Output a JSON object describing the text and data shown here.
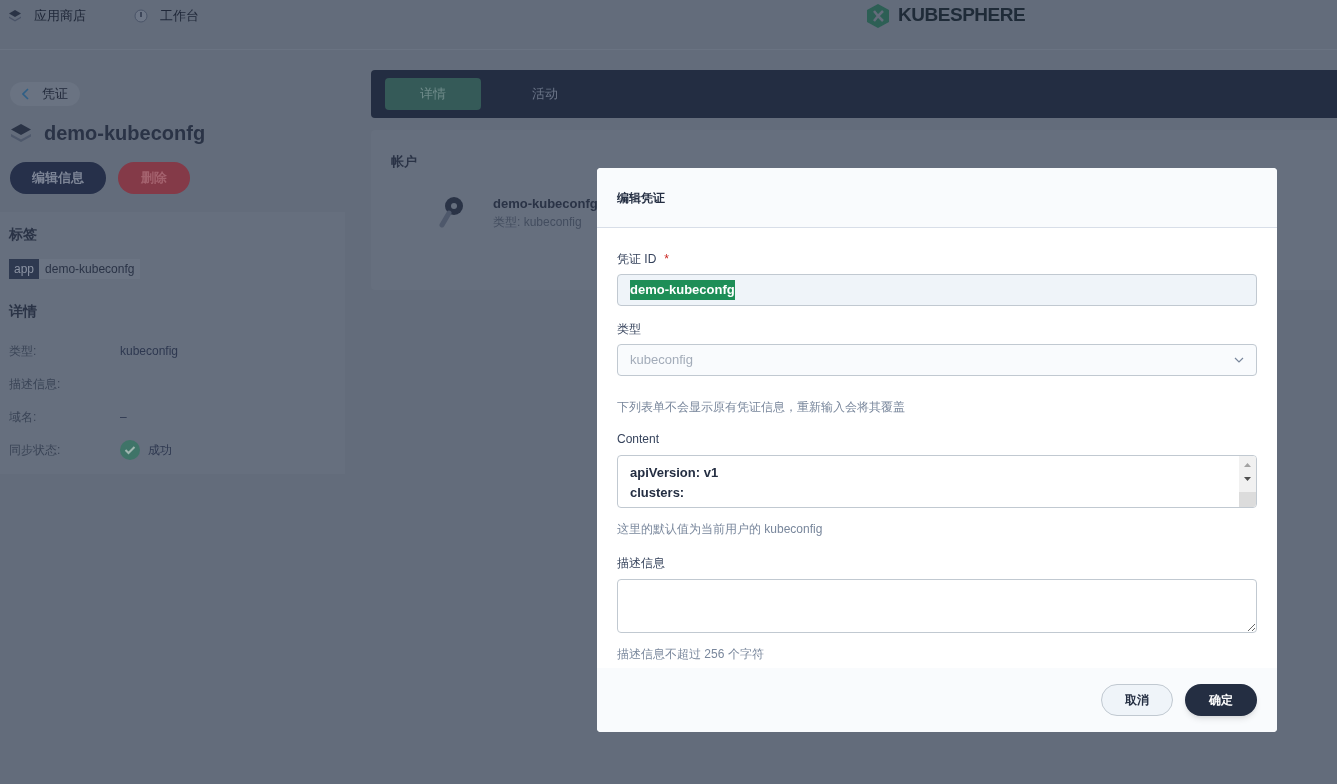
{
  "top_nav": {
    "items": [
      {
        "label": "应用商店",
        "kind": "store"
      },
      {
        "label": "工作台",
        "kind": "workbench"
      }
    ],
    "logo_text": "KUBESPHERE"
  },
  "sidebar": {
    "back_label": "凭证",
    "title": "demo-kubeconfg",
    "buttons": [
      {
        "label": "编辑信息",
        "kind": "primary"
      },
      {
        "label": "删除",
        "kind": "danger"
      }
    ],
    "labels_heading": "标签",
    "tags": [
      {
        "key": "app",
        "value": "demo-kubeconfg"
      }
    ],
    "details_heading": "详情",
    "details": [
      {
        "label": "类型:",
        "value": "kubeconfig",
        "kind": "text"
      },
      {
        "label": "描述信息:",
        "kind": "text"
      },
      {
        "label": "域名:",
        "value": "–",
        "kind": "text"
      },
      {
        "label": "同步状态:",
        "value": "成功",
        "kind": "status"
      }
    ]
  },
  "tabs": [
    {
      "label": "详情",
      "selected": true
    },
    {
      "label": "活动",
      "selected": false
    }
  ],
  "account": {
    "heading": "帐户",
    "name": "demo-kubeconfg",
    "type_text": "类型: kubeconfig"
  },
  "dialog": {
    "title": "编辑凭证",
    "id_field": {
      "label": "凭证 ID",
      "required_mark": "*",
      "value": "demo-kubeconfg",
      "value_selected": true
    },
    "type_field": {
      "label": "类型",
      "value": "kubeconfig",
      "disabled": true
    },
    "notice": "下列表单不会显示原有凭证信息，重新输入会将其覆盖",
    "content_field": {
      "label": "Content",
      "lines": [
        "apiVersion: v1",
        "clusters:"
      ],
      "hint": "这里的默认值为当前用户的 kubeconfig"
    },
    "description_field": {
      "label": "描述信息",
      "hint": "描述信息不超过 256 个字符"
    },
    "buttons": [
      {
        "label": "取消",
        "kind": "secondary"
      },
      {
        "label": "确定",
        "kind": "primary"
      }
    ]
  }
}
